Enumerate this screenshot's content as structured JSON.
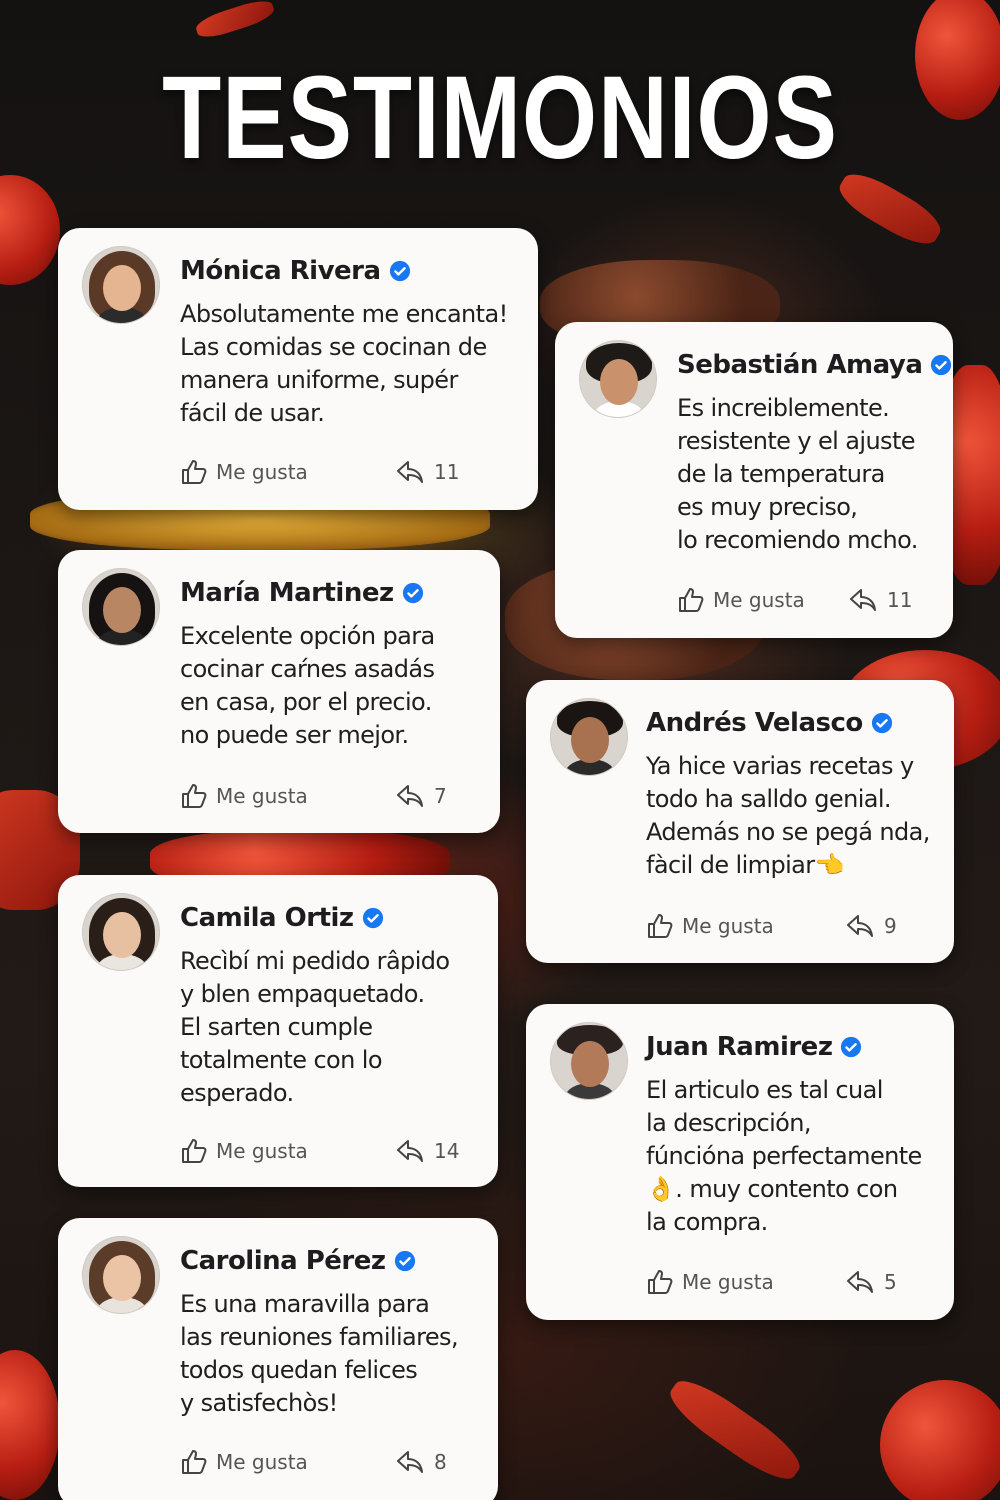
{
  "title": "TESTIMONIOS",
  "like_label": "Me gusta",
  "verified_color": "#1877f2",
  "testimonials": [
    {
      "name": "Mónica Rivera",
      "lines": [
        "Absolutamente me encanta!",
        "Las comidas se cocinan de",
        "manera uniforme, supér",
        "fácil de usar."
      ],
      "shares": "11"
    },
    {
      "name": "Sebastián Amaya",
      "lines": [
        "Es increiblemente.",
        "resistente y el ajuste",
        "de la temperatura",
        "es muy preciso,",
        "lo recomiendo mcho."
      ],
      "shares": "11"
    },
    {
      "name": "María Martinez",
      "lines": [
        "Excelente opción para",
        "cocinar caŕnes asadás",
        "en casa, por el precio.",
        "no puede ser mejor."
      ],
      "shares": "7"
    },
    {
      "name": "Andrés Velasco",
      "lines": [
        "Ya hice varias recetas y",
        "todo ha salldo genial.",
        "Además no se pegá nda,",
        "fàcil de limpiar👈"
      ],
      "shares": "9"
    },
    {
      "name": "Camila Ortiz",
      "lines": [
        "Recìbí mi pedido râpido",
        "y blen empaquetado.",
        "El sarten cumple",
        "totalmente con lo",
        "esperado."
      ],
      "shares": "14"
    },
    {
      "name": "Juan Ramirez",
      "lines": [
        "El articulo es tal cual",
        "la descripción,",
        "fúncióna perfectamente",
        "👌. muy contento con",
        "la compra."
      ],
      "shares": "5"
    },
    {
      "name": "Carolina Pérez",
      "lines": [
        "Es una maravilla para",
        "las reuniones familiares,",
        "todos quedan felices",
        "y satisfechòs!"
      ],
      "shares": "8"
    }
  ]
}
